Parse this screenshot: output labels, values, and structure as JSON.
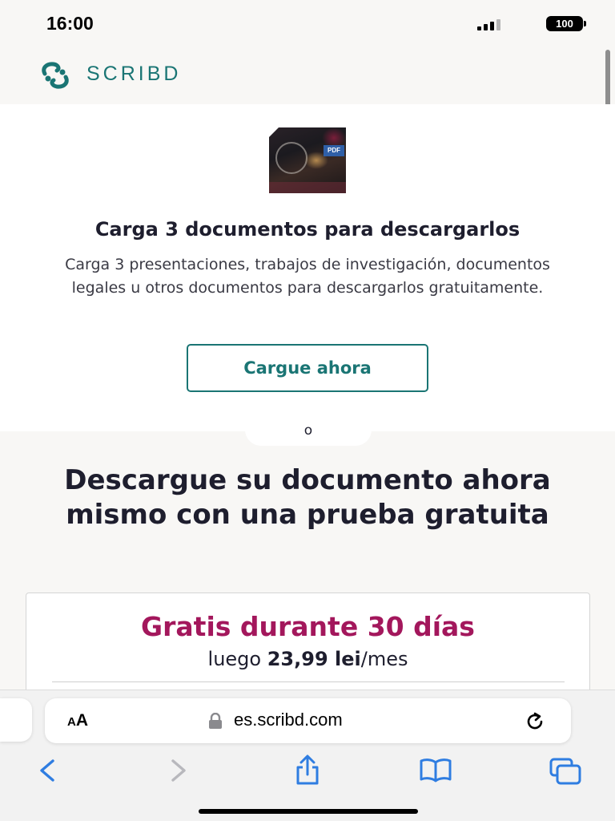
{
  "status_bar": {
    "time": "16:00",
    "battery": "100"
  },
  "header": {
    "logo_text": "SCRIBD",
    "logo_icon": "scribd-logo-icon",
    "brand_color": "#1a7574"
  },
  "upload_card": {
    "thumbnail_badge": "PDF",
    "title": "Carga 3 documentos para descargarlos",
    "body": "Carga 3 presentaciones, trabajos de investigación, documentos legales u otros documentos para descargarlos gratuitamente.",
    "button_label": "Cargue ahora"
  },
  "divider_label": "o",
  "trial": {
    "heading": "Descargue su documento ahora mismo con una prueba gratuita",
    "plan_free": "Gratis durante 30 días",
    "price_prefix": "luego ",
    "price_amount": "23,99 lei",
    "price_suffix": "/mes",
    "accent_color": "#a3175c"
  },
  "safari": {
    "aa_small": "A",
    "aa_big": "A",
    "url": "es.scribd.com",
    "icons": [
      "lock-icon",
      "reload-icon",
      "back-icon",
      "forward-icon",
      "share-icon",
      "bookmarks-icon",
      "tabs-icon"
    ],
    "link_color": "#2f7de1"
  }
}
